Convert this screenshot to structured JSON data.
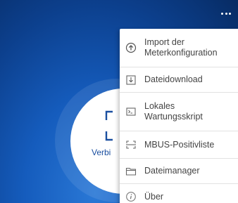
{
  "main": {
    "connect_label": "Verbi",
    "accent_color": "#155cbd",
    "connect_icon": "scan-bracket-icon"
  },
  "menu": {
    "items": [
      {
        "label": "Import der Meterkonfiguration",
        "icon": "upload-circle-icon"
      },
      {
        "label": "Dateidownload",
        "icon": "download-icon"
      },
      {
        "label": "Lokales Wartungsskript",
        "icon": "terminal-icon"
      },
      {
        "label": "MBUS-Positivliste",
        "icon": "scan-bracket-icon"
      },
      {
        "label": "Dateimanager",
        "icon": "folder-icon"
      },
      {
        "label": "Über",
        "icon": "info-icon"
      }
    ]
  }
}
